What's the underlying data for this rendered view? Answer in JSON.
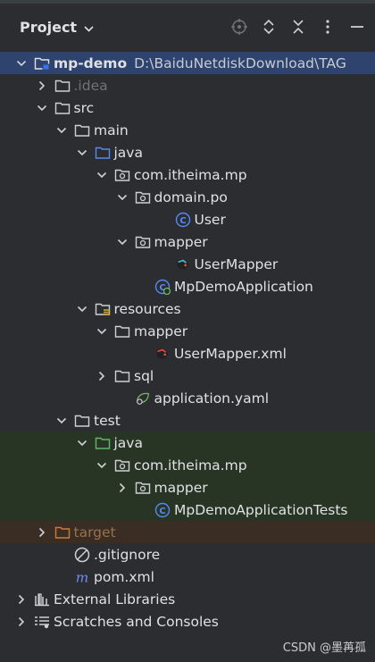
{
  "panel": {
    "title": "Project",
    "toolbar_icons": [
      "crosshair-icon",
      "expand-all-icon",
      "collapse-all-icon",
      "more-icon",
      "minimize-icon"
    ]
  },
  "tree": [
    {
      "label": "mp-demo",
      "path": "D:\\BaiduNetdiskDownload\\TAG",
      "icon": "module-folder-icon",
      "chevron": "down",
      "level": 0,
      "style": "selected"
    },
    {
      "label": ".idea",
      "icon": "folder-icon",
      "chevron": "right",
      "level": 1,
      "style": "dim"
    },
    {
      "label": "src",
      "icon": "folder-icon",
      "chevron": "down",
      "level": 1
    },
    {
      "label": "main",
      "icon": "folder-icon",
      "chevron": "down",
      "level": 2
    },
    {
      "label": "java",
      "icon": "source-folder-icon",
      "chevron": "down",
      "level": 3
    },
    {
      "label": "com.itheima.mp",
      "icon": "package-icon",
      "chevron": "down",
      "level": 4
    },
    {
      "label": "domain.po",
      "icon": "package-icon",
      "chevron": "down",
      "level": 5
    },
    {
      "label": "User",
      "icon": "class-icon",
      "chevron": "",
      "level": 7
    },
    {
      "label": "mapper",
      "icon": "package-icon",
      "chevron": "down",
      "level": 5
    },
    {
      "label": "UserMapper",
      "icon": "mybatis-interface-icon",
      "chevron": "",
      "level": 7
    },
    {
      "label": "MpDemoApplication",
      "icon": "spring-boot-class-icon",
      "chevron": "",
      "level": 6
    },
    {
      "label": "resources",
      "icon": "resources-folder-icon",
      "chevron": "down",
      "level": 3
    },
    {
      "label": "mapper",
      "icon": "folder-icon",
      "chevron": "down",
      "level": 4
    },
    {
      "label": "UserMapper.xml",
      "icon": "mybatis-xml-icon",
      "chevron": "",
      "level": 6
    },
    {
      "label": "sql",
      "icon": "folder-icon",
      "chevron": "right",
      "level": 4
    },
    {
      "label": "application.yaml",
      "icon": "spring-config-icon",
      "chevron": "",
      "level": 5
    },
    {
      "label": "test",
      "icon": "folder-icon",
      "chevron": "down",
      "level": 2
    },
    {
      "label": "java",
      "icon": "test-folder-icon",
      "chevron": "down",
      "level": 3,
      "style": "test"
    },
    {
      "label": "com.itheima.mp",
      "icon": "package-icon",
      "chevron": "down",
      "level": 4,
      "style": "test"
    },
    {
      "label": "mapper",
      "icon": "package-icon",
      "chevron": "right",
      "level": 5,
      "style": "test"
    },
    {
      "label": "MpDemoApplicationTests",
      "icon": "class-icon",
      "chevron": "",
      "level": 6,
      "style": "test"
    },
    {
      "label": "target",
      "icon": "excluded-folder-icon",
      "chevron": "right",
      "level": 1,
      "style": "excluded"
    },
    {
      "label": ".gitignore",
      "icon": "gitignore-icon",
      "chevron": "",
      "level": 2
    },
    {
      "label": "pom.xml",
      "icon": "maven-icon",
      "chevron": "",
      "level": 2
    },
    {
      "label": "External Libraries",
      "icon": "libraries-icon",
      "chevron": "right",
      "level": 0
    },
    {
      "label": "Scratches and Consoles",
      "icon": "scratches-icon",
      "chevron": "right",
      "level": 0
    }
  ],
  "watermark": "CSDN @墨苒孤",
  "colors": {
    "background": "#2b2d30",
    "selection": "#3574f0",
    "test_background": "#293524",
    "excluded_background": "#3a2e24",
    "package_blue": "#548af7",
    "test_green": "#5fb865",
    "excluded_orange": "#c77d3a"
  }
}
